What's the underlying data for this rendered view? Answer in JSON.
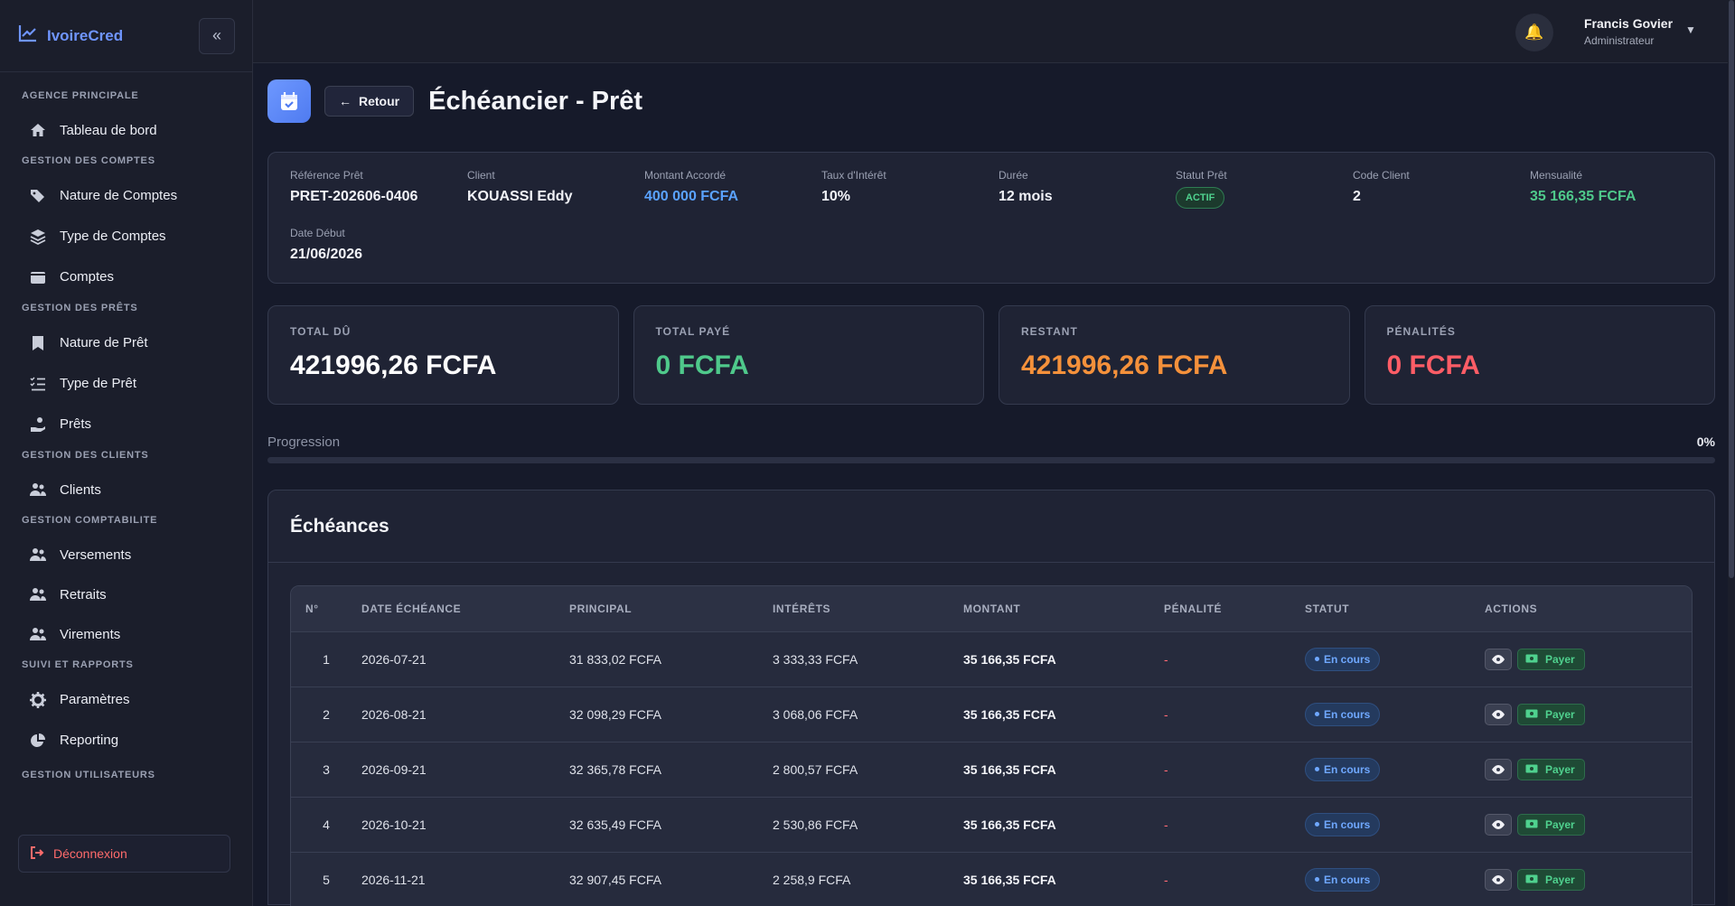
{
  "app": {
    "name": "IvoireCred"
  },
  "sidebar": {
    "sections": [
      {
        "title": "AGENCE PRINCIPALE",
        "items": [
          {
            "label": "Tableau de bord",
            "icon": "home-icon"
          }
        ]
      },
      {
        "title": "GESTION DES COMPTES",
        "items": [
          {
            "label": "Nature de Comptes",
            "icon": "tags-icon"
          },
          {
            "label": "Type de Comptes",
            "icon": "layers-icon"
          },
          {
            "label": "Comptes",
            "icon": "wallet-icon"
          }
        ]
      },
      {
        "title": "GESTION DES PRÊTS",
        "items": [
          {
            "label": "Nature de Prêt",
            "icon": "bookmark-icon"
          },
          {
            "label": "Type de Prêt",
            "icon": "list-check-icon"
          },
          {
            "label": "Prêts",
            "icon": "hand-coins-icon"
          }
        ]
      },
      {
        "title": "GESTION DES CLIENTS",
        "items": [
          {
            "label": "Clients",
            "icon": "users-icon"
          }
        ]
      },
      {
        "title": "GESTION COMPTABILITE",
        "items": [
          {
            "label": "Versements",
            "icon": "users-icon"
          },
          {
            "label": "Retraits",
            "icon": "users-icon"
          },
          {
            "label": "Virements",
            "icon": "users-icon"
          }
        ]
      },
      {
        "title": "SUIVI ET RAPPORTS",
        "items": [
          {
            "label": "Paramètres",
            "icon": "gear-icon"
          },
          {
            "label": "Reporting",
            "icon": "pie-chart-icon"
          }
        ]
      },
      {
        "title": "GESTION UTILISATEURS",
        "items": []
      }
    ],
    "logout_label": "Déconnexion"
  },
  "topbar": {
    "user_name": "Francis Govier",
    "user_role": "Administrateur"
  },
  "page": {
    "title": "Échéancier - Prêt",
    "back_label": "Retour"
  },
  "loan_info": {
    "fields": [
      {
        "label": "Référence Prêt",
        "value": "PRET-202606-0406",
        "tone": ""
      },
      {
        "label": "Client",
        "value": "KOUASSI Eddy",
        "tone": ""
      },
      {
        "label": "Montant Accordé",
        "value": "400 000 FCFA",
        "tone": "blue"
      },
      {
        "label": "Taux d'Intérêt",
        "value": "10%",
        "tone": ""
      },
      {
        "label": "Durée",
        "value": "12 mois",
        "tone": ""
      },
      {
        "label": "Statut Prêt",
        "value": "ACTIF",
        "tone": "pill"
      },
      {
        "label": "Code Client",
        "value": "2",
        "tone": ""
      },
      {
        "label": "Mensualité",
        "value": "35 166,35 FCFA",
        "tone": "green"
      },
      {
        "label": "Date Début",
        "value": "21/06/2026",
        "tone": ""
      }
    ]
  },
  "stats": [
    {
      "label": "TOTAL DÛ",
      "value": "421996,26 FCFA",
      "color": "white"
    },
    {
      "label": "TOTAL PAYÉ",
      "value": "0 FCFA",
      "color": "green"
    },
    {
      "label": "RESTANT",
      "value": "421996,26 FCFA",
      "color": "orange"
    },
    {
      "label": "PÉNALITÉS",
      "value": "0 FCFA",
      "color": "red"
    }
  ],
  "progress": {
    "label": "Progression",
    "percent_text": "0%",
    "fraction": 0
  },
  "schedule": {
    "title": "Échéances",
    "columns": [
      "N°",
      "DATE ÉCHÉANCE",
      "PRINCIPAL",
      "INTÉRÊTS",
      "MONTANT",
      "PÉNALITÉ",
      "STATUT",
      "ACTIONS"
    ],
    "status_label": "En cours",
    "pay_label": "Payer",
    "rows": [
      {
        "n": "1",
        "date": "2026-07-21",
        "principal": "31 833,02 FCFA",
        "interets": "3 333,33 FCFA",
        "montant": "35 166,35 FCFA",
        "penalite": "-"
      },
      {
        "n": "2",
        "date": "2026-08-21",
        "principal": "32 098,29 FCFA",
        "interets": "3 068,06 FCFA",
        "montant": "35 166,35 FCFA",
        "penalite": "-"
      },
      {
        "n": "3",
        "date": "2026-09-21",
        "principal": "32 365,78 FCFA",
        "interets": "2 800,57 FCFA",
        "montant": "35 166,35 FCFA",
        "penalite": "-"
      },
      {
        "n": "4",
        "date": "2026-10-21",
        "principal": "32 635,49 FCFA",
        "interets": "2 530,86 FCFA",
        "montant": "35 166,35 FCFA",
        "penalite": "-"
      },
      {
        "n": "5",
        "date": "2026-11-21",
        "principal": "32 907,45 FCFA",
        "interets": "2 258,9 FCFA",
        "montant": "35 166,35 FCFA",
        "penalite": "-"
      }
    ]
  },
  "colors": {
    "accent": "#6f95ff",
    "positive": "#4fc98b",
    "warning": "#f5913b",
    "danger": "#ff5d66"
  }
}
